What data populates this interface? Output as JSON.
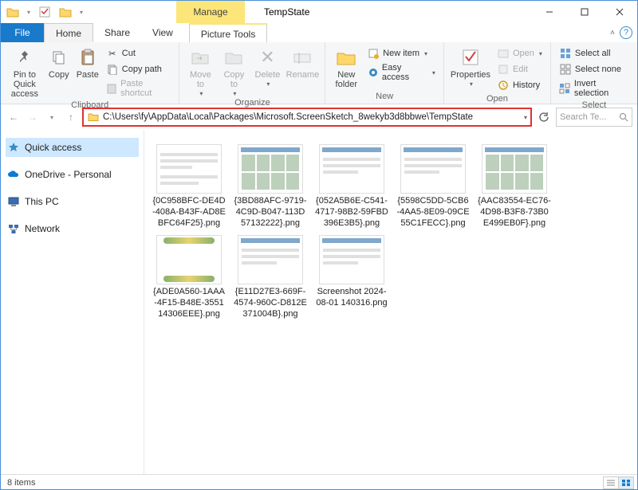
{
  "window": {
    "title": "TempState",
    "contextual_tab": "Manage",
    "contextual_tab_sub": "Picture Tools"
  },
  "menubar": {
    "file": "File",
    "home": "Home",
    "share": "Share",
    "view": "View",
    "picture_tools": "Picture Tools"
  },
  "ribbon": {
    "clipboard": {
      "label": "Clipboard",
      "pin": "Pin to Quick access",
      "copy": "Copy",
      "paste": "Paste",
      "cut": "Cut",
      "copy_path": "Copy path",
      "paste_shortcut": "Paste shortcut"
    },
    "organize": {
      "label": "Organize",
      "move_to": "Move to",
      "copy_to": "Copy to",
      "delete": "Delete",
      "rename": "Rename"
    },
    "new": {
      "label": "New",
      "new_folder": "New folder",
      "new_item": "New item",
      "easy_access": "Easy access"
    },
    "open": {
      "label": "Open",
      "properties": "Properties",
      "open": "Open",
      "edit": "Edit",
      "history": "History"
    },
    "select": {
      "label": "Select",
      "select_all": "Select all",
      "select_none": "Select none",
      "invert": "Invert selection"
    }
  },
  "nav": {
    "address": "C:\\Users\\fy\\AppData\\Local\\Packages\\Microsoft.ScreenSketch_8wekyb3d8bbwe\\TempState",
    "search_placeholder": "Search Te..."
  },
  "nav_pane": {
    "quick_access": "Quick access",
    "onedrive": "OneDrive - Personal",
    "this_pc": "This PC",
    "network": "Network"
  },
  "files": [
    {
      "name": "{0C958BFC-DE4D-408A-B43F-AD8EBFC64F25}.png",
      "thumb": "doclines"
    },
    {
      "name": "{3BD88AFC-9719-4C9D-B047-113D57132222}.png",
      "thumb": "grid"
    },
    {
      "name": "{052A5B6E-C541-4717-98B2-59FBD396E3B5}.png",
      "thumb": "text"
    },
    {
      "name": "{5598C5DD-5CB6-4AA5-8E09-09CE55C1FECC}.png",
      "thumb": "text"
    },
    {
      "name": "{AAC83554-EC76-4D98-B3F8-73B0E499EB0F}.png",
      "thumb": "grid"
    },
    {
      "name": "{ADE0A560-1AAA-4F15-B48E-355114306EEE}.png",
      "thumb": "deco"
    },
    {
      "name": "{E11D27E3-669F-4574-960C-D812E371004B}.png",
      "thumb": "text"
    },
    {
      "name": "Screenshot 2024-08-01 140316.png",
      "thumb": "text"
    }
  ],
  "status": {
    "count": "8 items"
  }
}
